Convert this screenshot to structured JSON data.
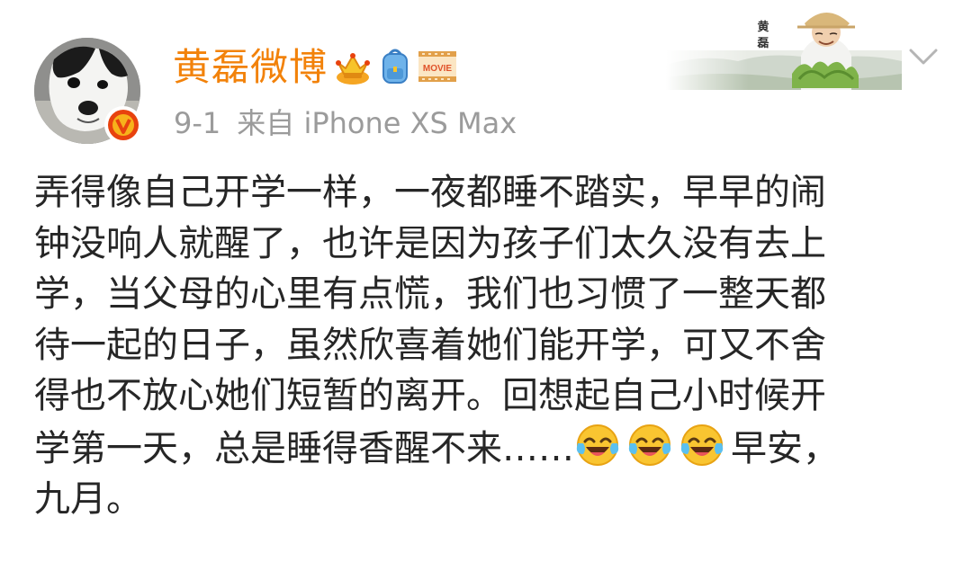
{
  "post": {
    "user": {
      "name": "黄磊微博",
      "verified": true,
      "badges": [
        {
          "icon": "crown-icon"
        },
        {
          "icon": "backpack-icon"
        },
        {
          "icon": "movie-badge-icon",
          "label": "MOVIE"
        }
      ]
    },
    "meta": {
      "time": "9-1",
      "source": "来自 iPhone XS Max"
    },
    "header_card": {
      "name": "黄磊"
    },
    "content": {
      "lines": [
        "弄得像自己开学一样，一夜都睡不踏实，早早的闹",
        "钟没响人就醒了，也许是因为孩子们太久没有去上",
        "学，当父母的心里有点慌，我们也习惯了一整天都",
        "待一起的日子，虽然欣喜着她们能开学，可又不舍",
        "得也不放心她们短暂的离开。回想起自己小时候开",
        "学第一天，总是睡得香醒不来……",
        "早安，",
        "九月。"
      ],
      "emoji": [
        "laughing-tears-emoji",
        "laughing-tears-emoji",
        "laughing-tears-emoji"
      ]
    },
    "colors": {
      "name": "#f2820a",
      "meta": "#9b9b9b",
      "text": "#262626",
      "verified_badge": "#e8420e",
      "emoji_face": "#f9c531"
    }
  }
}
